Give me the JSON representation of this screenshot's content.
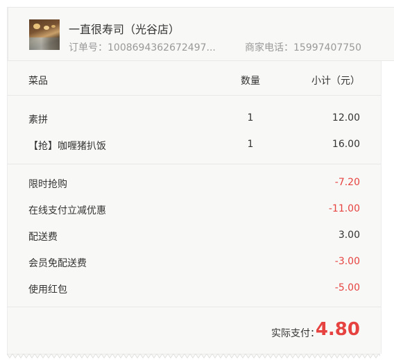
{
  "header": {
    "shop_name": "一直很寿司（光谷店）",
    "order_no": "订单号：1008694362672497...",
    "merchant_phone": "商家电话：15997407750"
  },
  "table": {
    "columns": {
      "name": "菜品",
      "qty": "数量",
      "subtotal": "小计（元）"
    },
    "items": [
      {
        "name": "素拼",
        "qty": "1",
        "subtotal": "12.00"
      },
      {
        "name": "【抢】咖喱猪扒饭",
        "qty": "1",
        "subtotal": "16.00"
      }
    ]
  },
  "fees": [
    {
      "name": "限时抢购",
      "amount": "-7.20",
      "negative": true
    },
    {
      "name": "在线支付立减优惠",
      "amount": "-11.00",
      "negative": true
    },
    {
      "name": "配送费",
      "amount": "3.00",
      "negative": false
    },
    {
      "name": "会员免配送费",
      "amount": "-3.00",
      "negative": true
    },
    {
      "name": "使用红包",
      "amount": "-5.00",
      "negative": true
    }
  ],
  "total": {
    "label": "实际支付：",
    "value": "4.80"
  },
  "colors": {
    "accent_red": "#e64340",
    "muted_text": "#999999",
    "background": "#f8f8f6"
  }
}
